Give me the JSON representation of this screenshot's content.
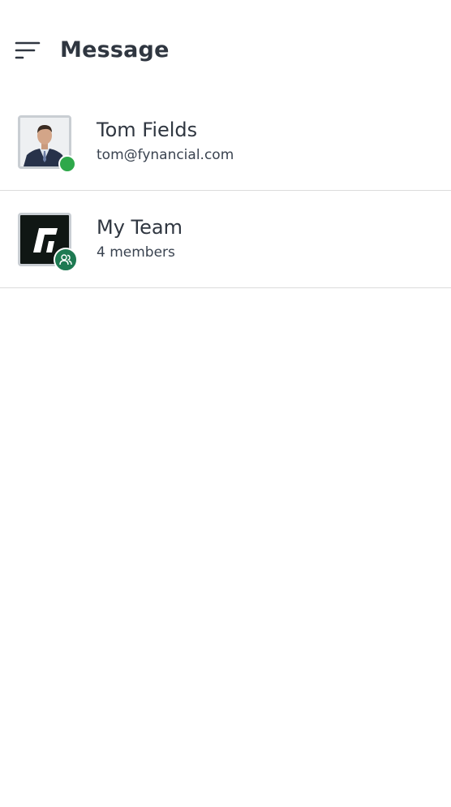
{
  "header": {
    "title": "Message",
    "menu_icon": "menu-icon"
  },
  "conversations": [
    {
      "name": "Tom Fields",
      "subtitle": "tom@fynancial.com",
      "avatar": "person-photo",
      "status": "online",
      "status_color": "#2ea84a"
    },
    {
      "name": "My Team",
      "subtitle": "4 members",
      "avatar": "team-logo",
      "badge_icon": "group-icon",
      "badge_color": "#1e7a52"
    }
  ]
}
